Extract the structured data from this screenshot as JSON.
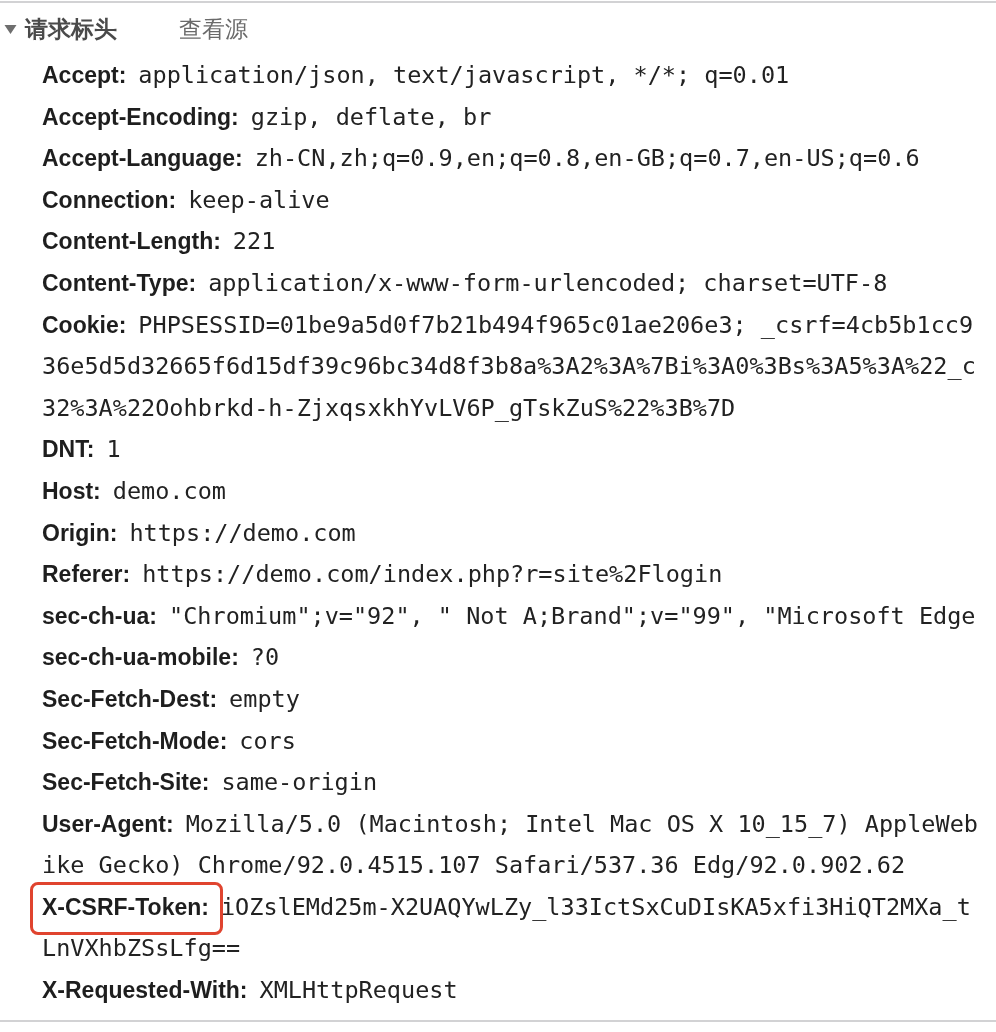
{
  "section": {
    "title": "请求标头",
    "expanded": true,
    "view_source": "查看源"
  },
  "headers": [
    {
      "name": "Accept:",
      "value_lines": [
        "application/json, text/javascript, */*; q=0.01"
      ],
      "highlighted": false
    },
    {
      "name": "Accept-Encoding:",
      "value_lines": [
        "gzip, deflate, br"
      ],
      "highlighted": false
    },
    {
      "name": "Accept-Language:",
      "value_lines": [
        "zh-CN,zh;q=0.9,en;q=0.8,en-GB;q=0.7,en-US;q=0.6"
      ],
      "highlighted": false
    },
    {
      "name": "Connection:",
      "value_lines": [
        "keep-alive"
      ],
      "highlighted": false
    },
    {
      "name": "Content-Length:",
      "value_lines": [
        "221"
      ],
      "highlighted": false
    },
    {
      "name": "Content-Type:",
      "value_lines": [
        "application/x-www-form-urlencoded; charset=UTF-8"
      ],
      "highlighted": false
    },
    {
      "name": "Cookie:",
      "value_lines": [
        "PHPSESSID=01be9a5d0f7b21b494f965c01ae206e3; _csrf=4cb5b1cc9",
        "36e5d5d32665f6d15df39c96bc34d8f3b8a%3A2%3A%7Bi%3A0%3Bs%3A5%3A%22_c",
        "32%3A%22Oohbrkd-h-ZjxqsxkhYvLV6P_gTskZuS%22%3B%7D"
      ],
      "highlighted": false
    },
    {
      "name": "DNT:",
      "value_lines": [
        "1"
      ],
      "highlighted": false
    },
    {
      "name": "Host:",
      "value_lines": [
        "demo.com"
      ],
      "highlighted": false
    },
    {
      "name": "Origin:",
      "value_lines": [
        "https://demo.com"
      ],
      "highlighted": false
    },
    {
      "name": "Referer:",
      "value_lines": [
        "https://demo.com/index.php?r=site%2Flogin"
      ],
      "highlighted": false
    },
    {
      "name": "sec-ch-ua:",
      "value_lines": [
        "\"Chromium\";v=\"92\", \" Not A;Brand\";v=\"99\", \"Microsoft Edge"
      ],
      "highlighted": false
    },
    {
      "name": "sec-ch-ua-mobile:",
      "value_lines": [
        "?0"
      ],
      "highlighted": false
    },
    {
      "name": "Sec-Fetch-Dest:",
      "value_lines": [
        "empty"
      ],
      "highlighted": false
    },
    {
      "name": "Sec-Fetch-Mode:",
      "value_lines": [
        "cors"
      ],
      "highlighted": false
    },
    {
      "name": "Sec-Fetch-Site:",
      "value_lines": [
        "same-origin"
      ],
      "highlighted": false
    },
    {
      "name": "User-Agent:",
      "value_lines": [
        "Mozilla/5.0 (Macintosh; Intel Mac OS X 10_15_7) AppleWeb",
        "ike Gecko) Chrome/92.0.4515.107 Safari/537.36 Edg/92.0.902.62"
      ],
      "highlighted": false
    },
    {
      "name": "X-CSRF-Token:",
      "value_lines": [
        "iOZslEMd25m-X2UAQYwLZy_l33IctSxCuDIsKA5xfi3HiQT2MXa_t",
        "LnVXhbZSsLfg=="
      ],
      "highlighted": true
    },
    {
      "name": "X-Requested-With:",
      "value_lines": [
        "XMLHttpRequest"
      ],
      "highlighted": false
    }
  ]
}
